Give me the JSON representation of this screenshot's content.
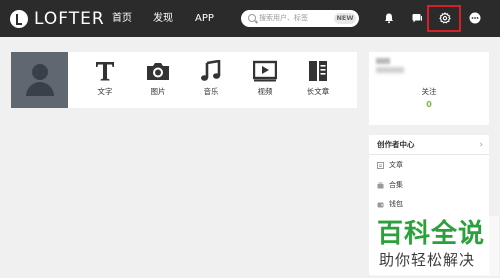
{
  "header": {
    "logo_text": "LOFTER",
    "nav": [
      {
        "label": "首页"
      },
      {
        "label": "发现"
      },
      {
        "label": "APP"
      }
    ],
    "search": {
      "placeholder": "搜索用户、标签",
      "badge": "NEW"
    },
    "icons": [
      "bell-icon",
      "chat-icon",
      "gear-icon",
      "more-icon"
    ]
  },
  "publish": {
    "items": [
      {
        "label": "文字",
        "icon": "text-icon"
      },
      {
        "label": "图片",
        "icon": "camera-icon"
      },
      {
        "label": "音乐",
        "icon": "music-icon"
      },
      {
        "label": "视频",
        "icon": "video-icon"
      },
      {
        "label": "长文章",
        "icon": "article-icon"
      }
    ]
  },
  "profile": {
    "follow_label": "关注",
    "follow_count": "0"
  },
  "creator": {
    "title": "创作者中心",
    "items": [
      {
        "label": "文章"
      },
      {
        "label": "合集"
      },
      {
        "label": "钱包"
      }
    ]
  },
  "watermark": {
    "title": "百科全说",
    "subtitle": "助你轻松解决"
  },
  "colors": {
    "topbar": "#2b2b2b",
    "accent_green": "#7cb342",
    "highlight_red": "#d4202a",
    "watermark_green": "#2aa13a"
  }
}
